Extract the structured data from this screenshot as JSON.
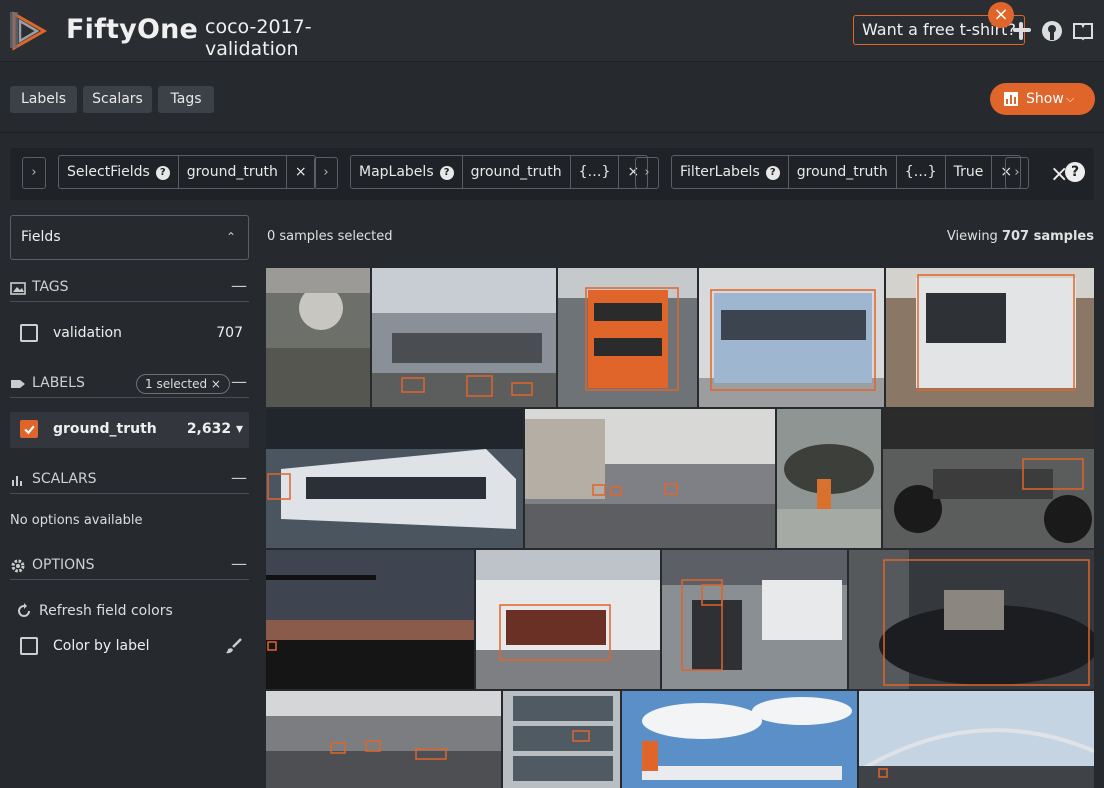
{
  "header": {
    "brand": "FiftyOne",
    "dataset": "coco-2017-validation",
    "promo": "Want a free t-shirt?",
    "promo_close": "×",
    "accent": "#e0652a"
  },
  "nav": {
    "labels": "Labels",
    "scalars": "Scalars",
    "tags": "Tags",
    "show": "Show"
  },
  "viewbar": {
    "stages": [
      {
        "name": "SelectFields",
        "help": "?",
        "args": [
          "ground_truth"
        ]
      },
      {
        "name": "MapLabels",
        "help": "?",
        "args": [
          "ground_truth",
          "{…}"
        ]
      },
      {
        "name": "FilterLabels",
        "help": "?",
        "args": [
          "ground_truth",
          "{…}",
          "True"
        ]
      }
    ],
    "remove": "×",
    "close": "×",
    "help": "?"
  },
  "sidebar": {
    "fields_label": "Fields",
    "tags_section": "TAGS",
    "tags": [
      {
        "name": "validation",
        "count": "707"
      }
    ],
    "labels_section": "LABELS",
    "labels_pill": "1 selected ×",
    "labels": [
      {
        "name": "ground_truth",
        "count": "2,632 ▾",
        "checked": true
      }
    ],
    "scalars_section": "SCALARS",
    "scalars_empty": "No options available",
    "options_section": "OPTIONS",
    "refresh": "Refresh field colors",
    "color_by_label": "Color by label",
    "collapse": "—"
  },
  "grid": {
    "selected_text": "0 samples selected",
    "viewing_prefix": "Viewing ",
    "viewing_count": "707 samples"
  }
}
